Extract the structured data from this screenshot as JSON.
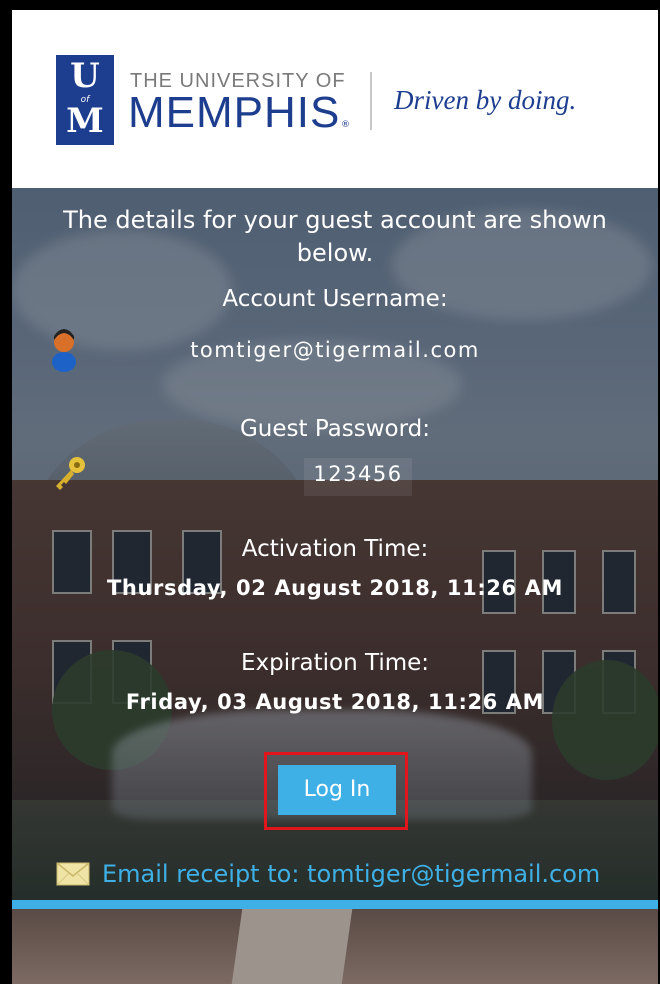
{
  "header": {
    "logo_letters_top": "U",
    "logo_letters_bottom": "M",
    "logo_of": "of",
    "university_line": "THE UNIVERSITY OF",
    "university_name": "MEMPHIS",
    "registered_mark": "®",
    "tagline": "Driven by doing."
  },
  "intro_text": "The details for your guest account are shown below.",
  "account": {
    "username_label": "Account Username:",
    "username_value": "tomtiger@tigermail.com",
    "username_icon": "person-icon",
    "password_label": "Guest Password:",
    "password_value": "123456",
    "password_icon": "key-icon"
  },
  "activation": {
    "label": "Activation Time:",
    "value": "Thursday, 02 August 2018, 11:26 AM"
  },
  "expiration": {
    "label": "Expiration Time:",
    "value": "Friday, 03 August 2018, 11:26 AM"
  },
  "login_button": "Log In",
  "email_receipt": {
    "icon": "envelope-icon",
    "text": "Email receipt to: tomtiger@tigermail.com"
  },
  "colors": {
    "brand_blue": "#1d3d8f",
    "accent": "#3fb0e6",
    "highlight": "#e0161c"
  }
}
